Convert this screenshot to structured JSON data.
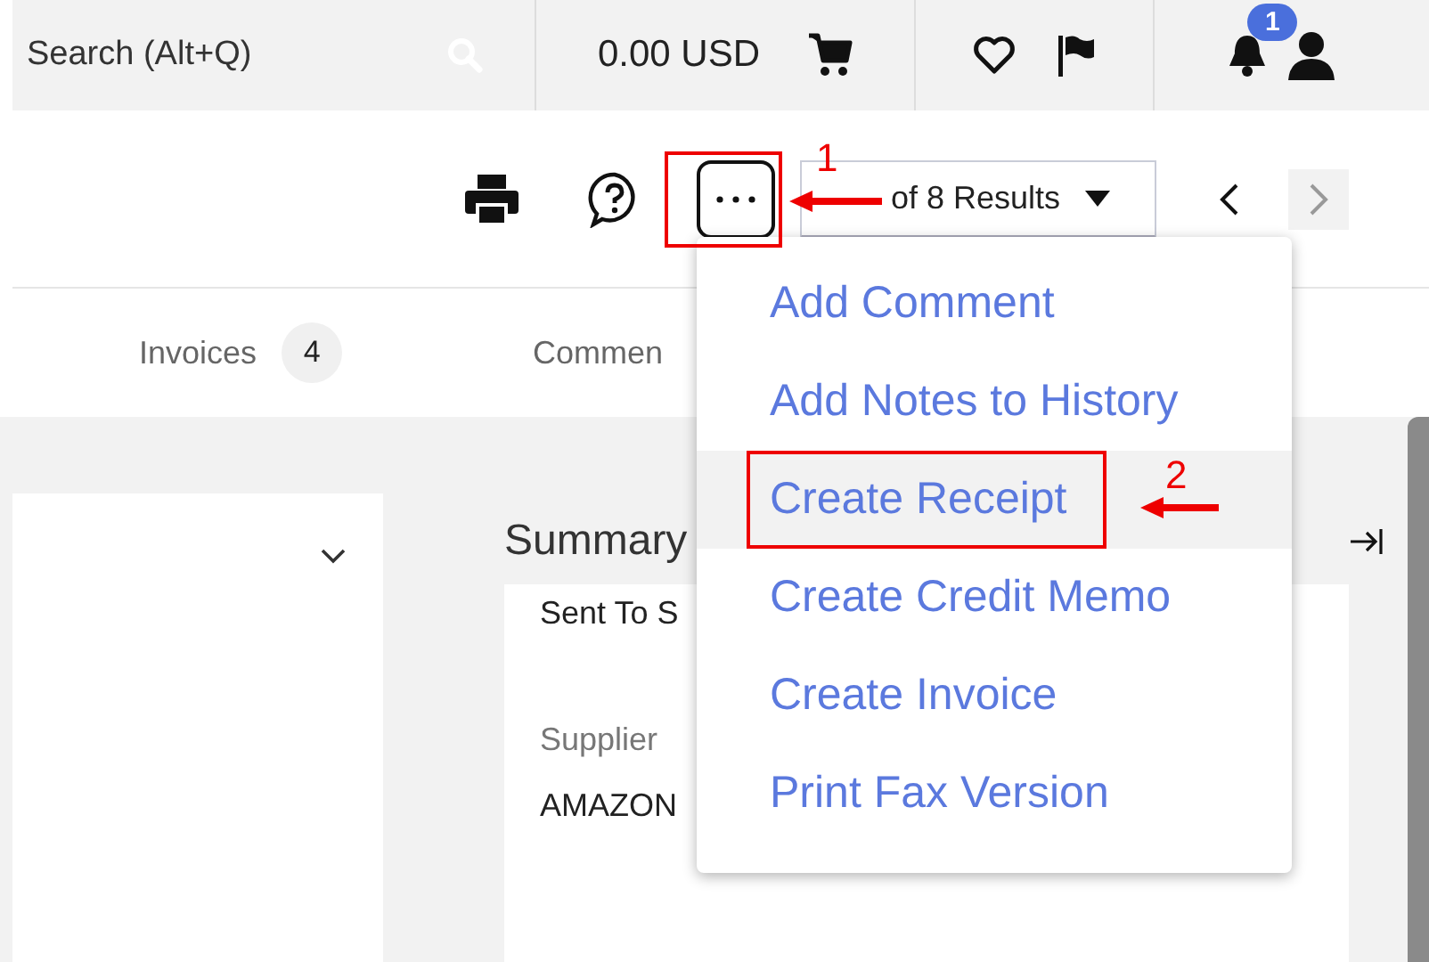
{
  "top_bar": {
    "search": {
      "placeholder": "Search (Alt+Q)"
    },
    "cart_total": "0.00 USD",
    "notification_count": "1"
  },
  "toolbar": {
    "results": "of 8 Results",
    "previous_disabled": false,
    "next_disabled": true
  },
  "tabs": [
    {
      "label": "Invoices",
      "count": "4"
    },
    {
      "label": "Commen"
    }
  ],
  "summary": {
    "title": "Summary",
    "fields": [
      {
        "label": "Sent To S"
      },
      {
        "label": "Supplier",
        "value": "AMAZON"
      }
    ]
  },
  "menu": {
    "items": [
      {
        "label": "Add Comment",
        "selected": false
      },
      {
        "label": "Add Notes to History",
        "selected": false
      },
      {
        "label": "Create Receipt",
        "selected": true
      },
      {
        "label": "Create Credit Memo",
        "selected": false
      },
      {
        "label": "Create Invoice",
        "selected": false
      },
      {
        "label": "Print Fax Version",
        "selected": false
      }
    ]
  },
  "annotations": [
    {
      "number": "1"
    },
    {
      "number": "2"
    }
  ]
}
